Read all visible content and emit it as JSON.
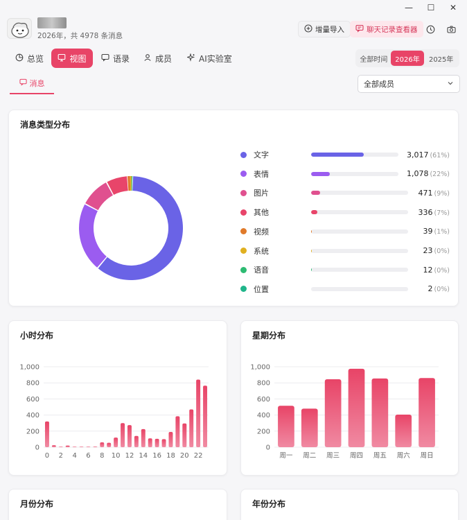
{
  "window": {
    "minimize": "—",
    "maximize": "☐",
    "close": "✕"
  },
  "header": {
    "subtitle": "2026年，共 4978 条消息",
    "import_label": "增量导入",
    "viewer_label": "聊天记录查看器"
  },
  "nav": {
    "tabs": [
      {
        "label": "总览",
        "icon": "pie-icon"
      },
      {
        "label": "视图",
        "icon": "monitor-icon",
        "active": true
      },
      {
        "label": "语录",
        "icon": "quote-icon"
      },
      {
        "label": "成员",
        "icon": "members-icon"
      },
      {
        "label": "AI实验室",
        "icon": "sparkle-icon"
      }
    ]
  },
  "year_filter": {
    "options": [
      "全部时间",
      "2026年",
      "2025年"
    ],
    "selected": "2026年"
  },
  "subnav": {
    "tab_label": "消息",
    "member_select": "全部成员"
  },
  "colors": {
    "accent": "#e84467",
    "accent_light": "#fde7ec"
  },
  "chart_data": [
    {
      "type": "pie",
      "title": "消息类型分布",
      "categories": [
        "文字",
        "表情",
        "图片",
        "其他",
        "视频",
        "系统",
        "语音",
        "位置"
      ],
      "values": [
        3017,
        1078,
        471,
        336,
        39,
        23,
        12,
        2
      ],
      "value_labels": [
        "3,017",
        "1,078",
        "471",
        "336",
        "39",
        "23",
        "12",
        "2"
      ],
      "percent_labels": [
        "(61%)",
        "(22%)",
        "(9%)",
        "(7%)",
        "(1%)",
        "(0%)",
        "(0%)",
        "(0%)"
      ],
      "colors": [
        "#6a63e6",
        "#9b5cf0",
        "#e0508f",
        "#e8456a",
        "#e07a2a",
        "#e0b020",
        "#2dbb72",
        "#20b58a"
      ]
    },
    {
      "type": "bar",
      "title": "小时分布",
      "x": [
        0,
        1,
        2,
        3,
        4,
        5,
        6,
        7,
        8,
        9,
        10,
        11,
        12,
        13,
        14,
        15,
        16,
        17,
        18,
        19,
        20,
        21,
        22,
        23
      ],
      "values": [
        320,
        25,
        5,
        20,
        5,
        3,
        5,
        8,
        60,
        55,
        120,
        300,
        275,
        140,
        225,
        110,
        105,
        100,
        190,
        385,
        295,
        470,
        840,
        765
      ],
      "x_tick_labels": [
        "0",
        "2",
        "4",
        "6",
        "8",
        "10",
        "12",
        "14",
        "16",
        "18",
        "20",
        "22"
      ],
      "ylim": [
        0,
        1000
      ],
      "y_ticks": [
        "0",
        "200",
        "400",
        "600",
        "800",
        "1,000"
      ],
      "grid": true
    },
    {
      "type": "bar",
      "title": "星期分布",
      "categories": [
        "周一",
        "周二",
        "周三",
        "周四",
        "周五",
        "周六",
        "周日"
      ],
      "values": [
        515,
        480,
        845,
        975,
        855,
        405,
        860
      ],
      "ylim": [
        0,
        1000
      ],
      "y_ticks": [
        "0",
        "200",
        "400",
        "600",
        "800",
        "1,000"
      ],
      "grid": true
    }
  ],
  "bottom_cards": {
    "month_title": "月份分布",
    "year_title": "年份分布"
  }
}
